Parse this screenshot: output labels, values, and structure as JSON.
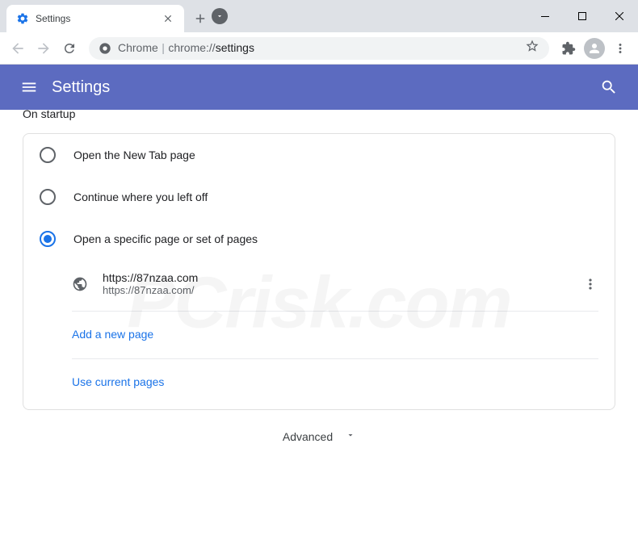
{
  "tab": {
    "title": "Settings"
  },
  "url": {
    "scheme": "Chrome",
    "path": "chrome://settings"
  },
  "header": {
    "title": "Settings"
  },
  "section": {
    "title": "On startup"
  },
  "options": [
    {
      "label": "Open the New Tab page"
    },
    {
      "label": "Continue where you left off"
    },
    {
      "label": "Open a specific page or set of pages"
    }
  ],
  "pages": [
    {
      "title": "https://87nzaa.com",
      "url": "https://87nzaa.com/"
    }
  ],
  "links": {
    "add": "Add a new page",
    "use_current": "Use current pages"
  },
  "advanced": "Advanced",
  "watermark": "PCrisk.com"
}
